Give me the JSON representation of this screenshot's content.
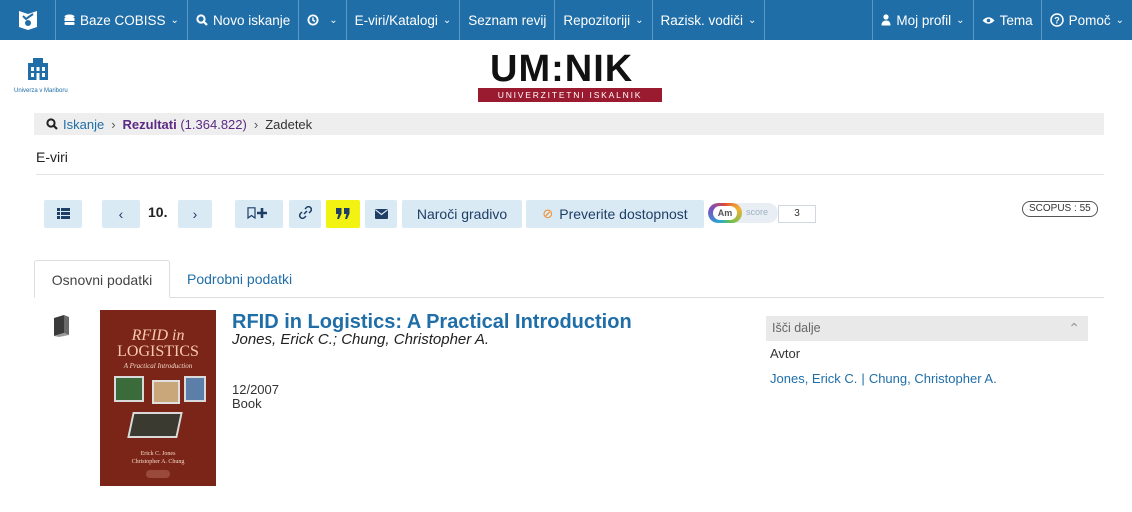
{
  "nav": {
    "items": [
      {
        "label": "Baze COBISS",
        "icon": "database-icon",
        "has_dropdown": true
      },
      {
        "label": "Novo iskanje",
        "icon": "search-icon",
        "has_dropdown": false
      },
      {
        "label": "",
        "icon": "history-icon",
        "has_dropdown": true
      },
      {
        "label": "E-viri/Katalogi",
        "icon": "",
        "has_dropdown": true
      },
      {
        "label": "Seznam revij",
        "icon": "",
        "has_dropdown": false
      },
      {
        "label": "Repozitoriji",
        "icon": "",
        "has_dropdown": true
      },
      {
        "label": "Razisk. vodiči",
        "icon": "",
        "has_dropdown": true
      }
    ],
    "right_items": [
      {
        "label": "Moj profil",
        "icon": "user-icon",
        "has_dropdown": true
      },
      {
        "label": "Tema",
        "icon": "eye-icon",
        "has_dropdown": false
      },
      {
        "label": "Pomoč",
        "icon": "help-icon",
        "has_dropdown": true
      }
    ]
  },
  "header": {
    "university": "Univerza v Mariboru",
    "brand": "UM:NIK",
    "brand_tagline": "UNIVERZITETNI ISKALNIK"
  },
  "breadcrumb": {
    "search": "Iskanje",
    "results": "Rezultati",
    "results_count": "(1.364.822)",
    "current": "Zadetek"
  },
  "section_title": "E-viri",
  "toolbar": {
    "page_number": "10.",
    "order_label": "Naroči gradivo",
    "availability_label": "Preverite dostopnost",
    "altmetric_badge": "Am",
    "altmetric_score_label": "score",
    "altmetric_count": "3",
    "scopus_badge": "SCOPUS : 55"
  },
  "tabs": [
    {
      "label": "Osnovni podatki",
      "active": true
    },
    {
      "label": "Podrobni podatki",
      "active": false
    }
  ],
  "result": {
    "title": "RFID in Logistics: A Practical Introduction",
    "authors": "Jones, Erick C.; Chung, Christopher A.",
    "date": "12/2007",
    "type": "Book",
    "cover": {
      "title_line1": "RFID in",
      "title_line2": "LOGISTICS",
      "subtitle": "A Practical Introduction",
      "author_line1": "Erick C. Jones",
      "author_line2": "Christopher A. Chung"
    }
  },
  "side_panel": {
    "header": "Išči dalje",
    "label": "Avtor",
    "links": [
      "Jones, Erick C.",
      "Chung, Christopher A."
    ]
  },
  "colors": {
    "nav_bg": "#1f6ea8",
    "link": "#1f6ea8",
    "brand_bar": "#9a1b30",
    "button_bg": "#d9eaf4",
    "cite_highlight": "#f2f213"
  }
}
